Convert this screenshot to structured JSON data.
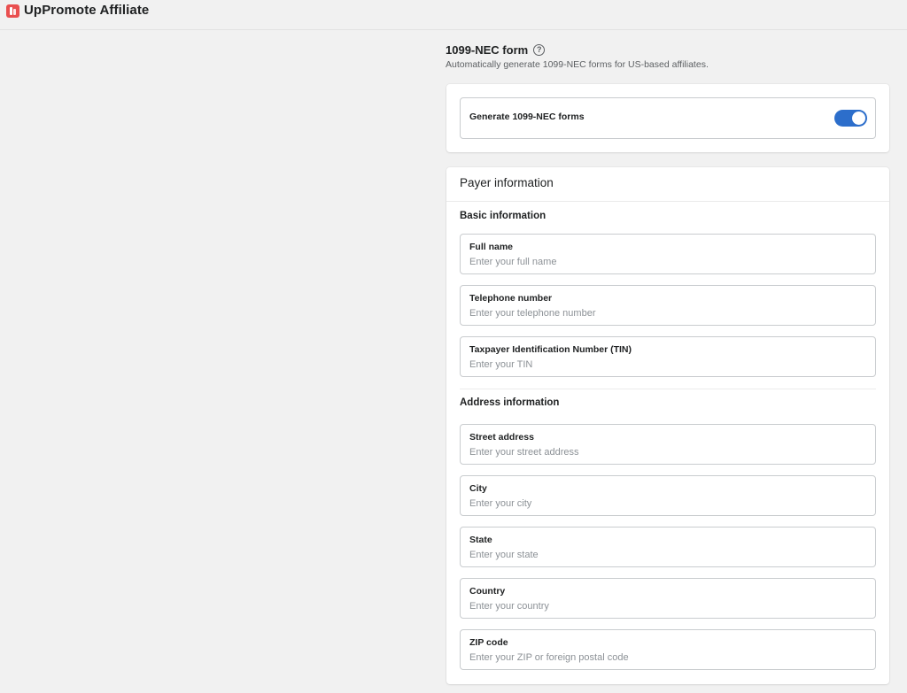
{
  "app": {
    "title": "UpPromote Affiliate",
    "logo_icon": "uppromote-logo-icon",
    "accent_color": "#e94f4f"
  },
  "section": {
    "title": "1099-NEC form",
    "help_icon": "question-circle-icon",
    "subtitle": "Automatically generate 1099-NEC forms for US-based affiliates."
  },
  "generate_toggle": {
    "label": "Generate 1099-NEC forms",
    "enabled": true,
    "color": "#2c6ecb"
  },
  "payer": {
    "title": "Payer information",
    "basic": {
      "title": "Basic information",
      "fields": [
        {
          "label": "Full name",
          "placeholder": "Enter your full name",
          "value": ""
        },
        {
          "label": "Telephone number",
          "placeholder": "Enter your telephone number",
          "value": ""
        },
        {
          "label": "Taxpayer Identification Number (TIN)",
          "placeholder": "Enter your TIN",
          "value": ""
        }
      ]
    },
    "address": {
      "title": "Address information",
      "fields": [
        {
          "label": "Street address",
          "placeholder": "Enter your street address",
          "value": ""
        },
        {
          "label": "City",
          "placeholder": "Enter your city",
          "value": ""
        },
        {
          "label": "State",
          "placeholder": "Enter your state",
          "value": ""
        },
        {
          "label": "Country",
          "placeholder": "Enter your country",
          "value": ""
        },
        {
          "label": "ZIP code",
          "placeholder": "Enter your ZIP or foreign postal code",
          "value": ""
        }
      ]
    }
  }
}
